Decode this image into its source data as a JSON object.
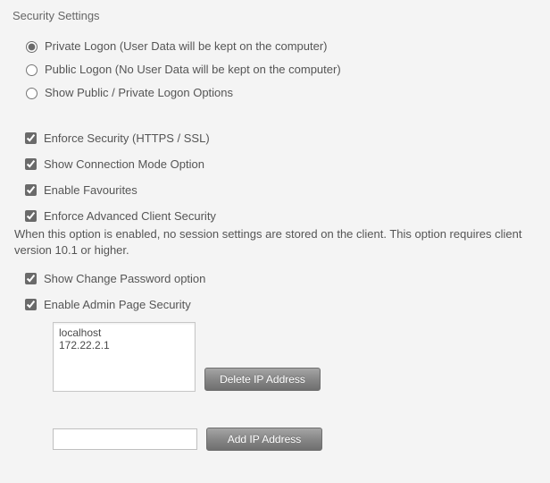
{
  "title": "Security Settings",
  "logon": {
    "private_label": "Private Logon (User Data will be kept on the computer)",
    "public_label": "Public Logon (No User Data will be kept on the computer)",
    "show_options_label": "Show Public / Private Logon Options"
  },
  "options": {
    "enforce_security": "Enforce Security (HTTPS / SSL)",
    "show_conn_mode": "Show Connection Mode Option",
    "enable_favourites": "Enable Favourites",
    "enforce_adv_client": "Enforce Advanced Client Security",
    "enforce_adv_client_help": "When this option is enabled, no session settings are stored on the client. This option requires client version 10.1 or higher.",
    "show_change_pw": "Show Change Password option",
    "enable_admin_sec": "Enable Admin Page Security"
  },
  "ip": {
    "list_text": "localhost\n172.22.2.1",
    "input_value": "",
    "delete_button": "Delete IP Address",
    "add_button": "Add IP Address"
  }
}
